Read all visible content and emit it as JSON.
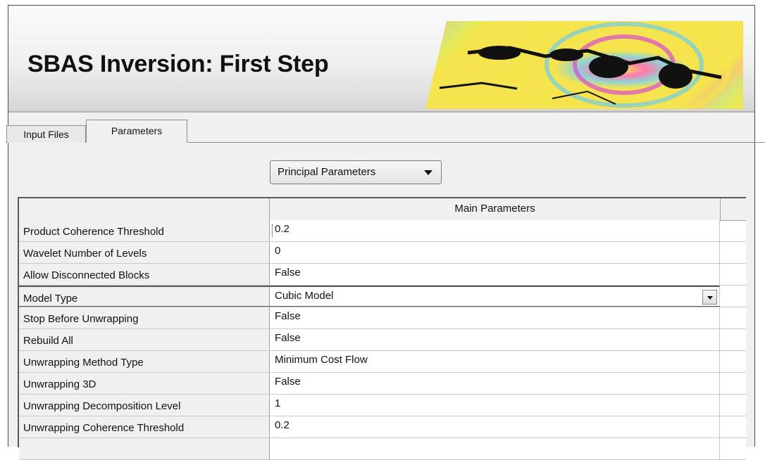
{
  "banner": {
    "title": "SBAS Inversion: First Step"
  },
  "tabs": [
    {
      "label": "Input Files"
    },
    {
      "label": "Parameters"
    }
  ],
  "section_dropdown": {
    "selected": "Principal Parameters"
  },
  "table": {
    "column_header": "Main Parameters",
    "rows": [
      {
        "label": "Product Coherence Threshold",
        "value": "0.2"
      },
      {
        "label": "Wavelet Number of Levels",
        "value": "0"
      },
      {
        "label": "Allow Disconnected Blocks",
        "value": "False"
      },
      {
        "label": "Model Type",
        "value": "Cubic Model"
      },
      {
        "label": "Stop Before Unwrapping",
        "value": "False"
      },
      {
        "label": "Rebuild All",
        "value": "False"
      },
      {
        "label": "Unwrapping Method Type",
        "value": "Minimum Cost Flow"
      },
      {
        "label": "Unwrapping 3D",
        "value": "False"
      },
      {
        "label": "Unwrapping Decomposition Level",
        "value": "1"
      },
      {
        "label": "Unwrapping Coherence Threshold",
        "value": "0.2"
      },
      {
        "label": "",
        "value": ""
      }
    ]
  }
}
